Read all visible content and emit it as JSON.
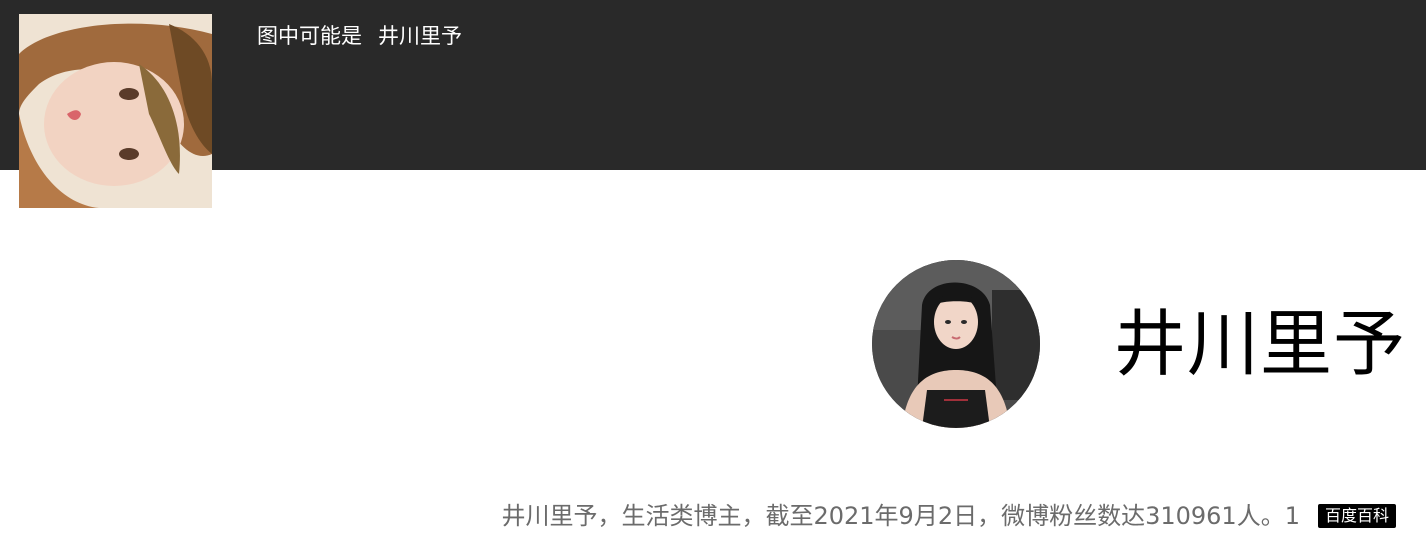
{
  "header": {
    "caption_prefix": "图中可能是",
    "caption_name": "井川里予"
  },
  "thumbnail": {
    "alt": "井川里予"
  },
  "entity": {
    "name": "井川里予",
    "description": "井川里予，生活类博主，截至2021年9月2日，微博粉丝数达310961人。1",
    "source_badge": "百度百科"
  },
  "colors": {
    "topbar": "#292929",
    "caption_text": "#ffffff",
    "description_text": "#6b6b6b",
    "badge_bg": "#000000"
  }
}
